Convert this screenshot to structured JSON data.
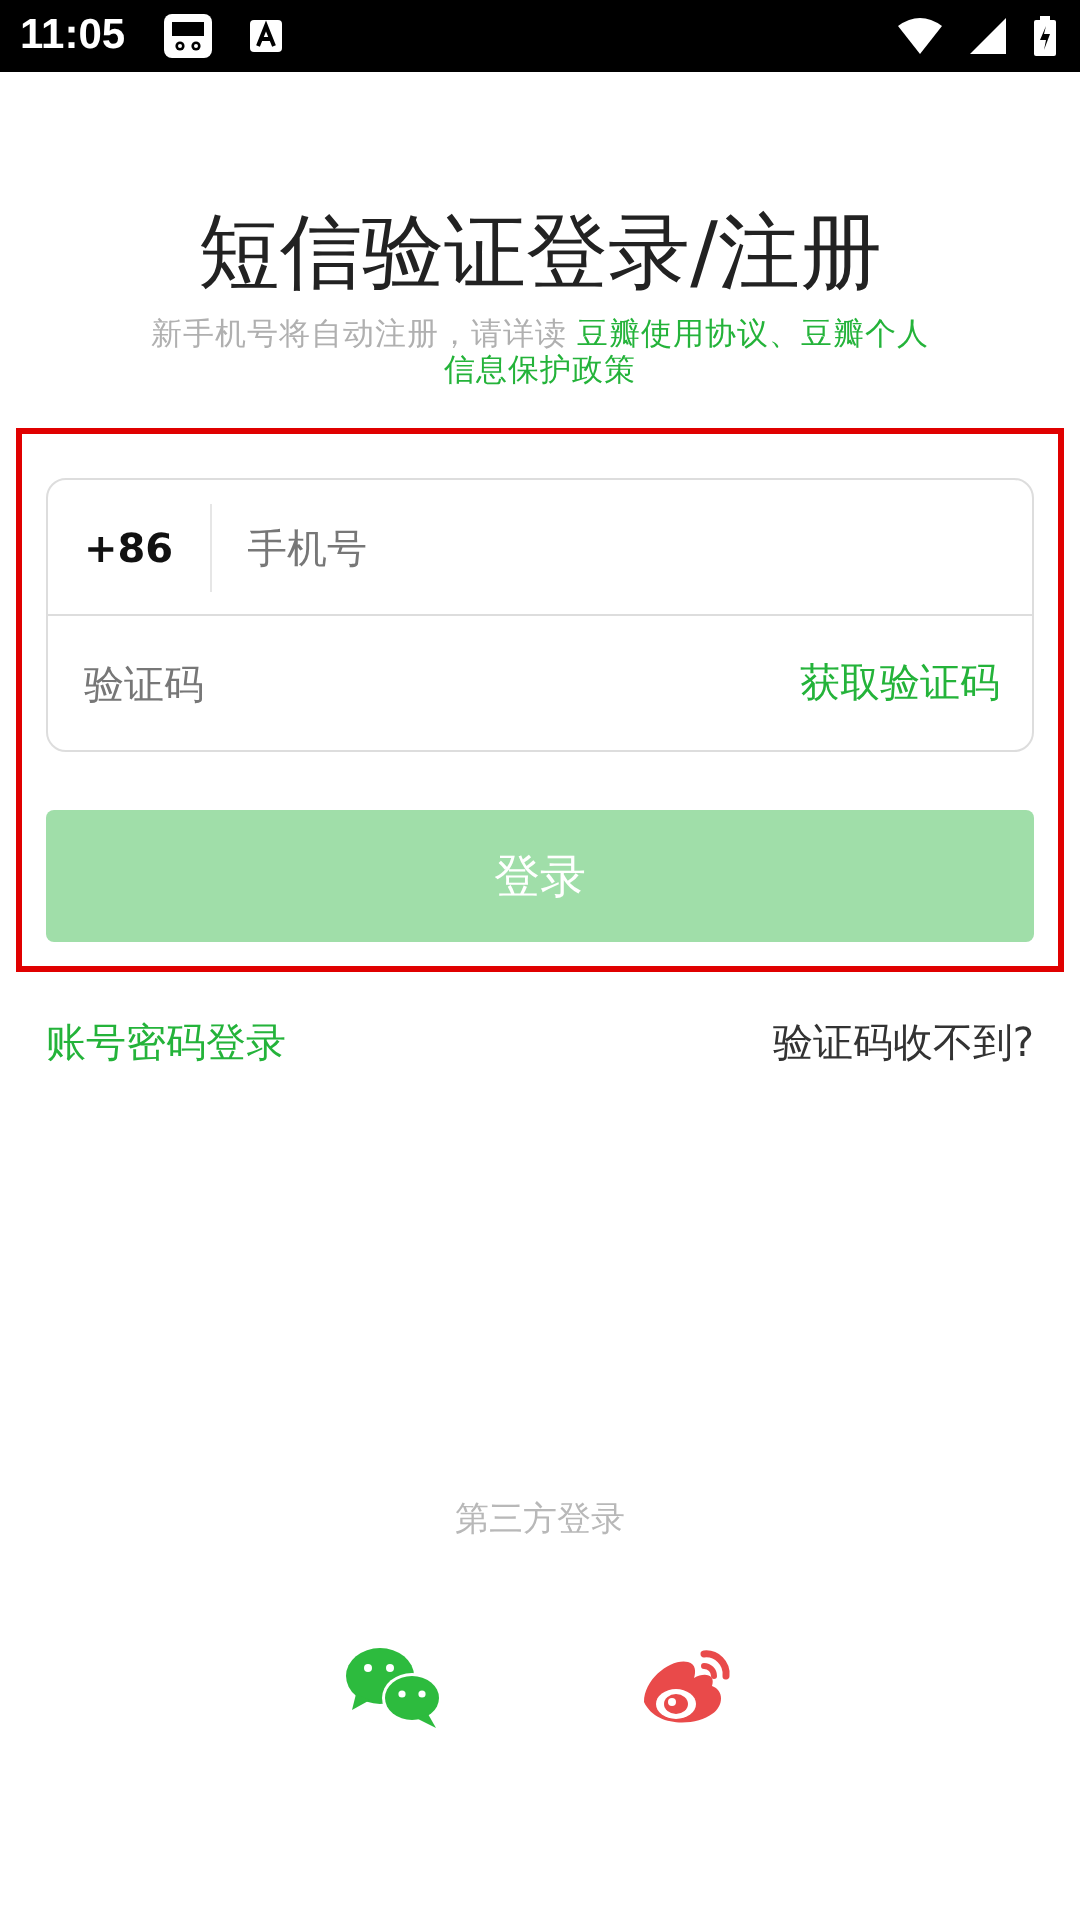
{
  "status_bar": {
    "time": "11:05"
  },
  "title": "短信验证登录/注册",
  "notice": {
    "text": "新手机号将自动注册，请详读 ",
    "link_lines": [
      "豆瓣使用协议、豆瓣个人",
      "信息保护政策"
    ]
  },
  "form": {
    "country_code": "+86",
    "phone": {
      "placeholder": "手机号"
    },
    "code": {
      "placeholder": "验证码"
    },
    "get_code": "获取验证码"
  },
  "login_button": {
    "label": "登录",
    "disabled": true
  },
  "links": {
    "password_login": "账号密码登录",
    "no_code": "验证码收不到?"
  },
  "third_party": {
    "label": "第三方登录"
  }
}
